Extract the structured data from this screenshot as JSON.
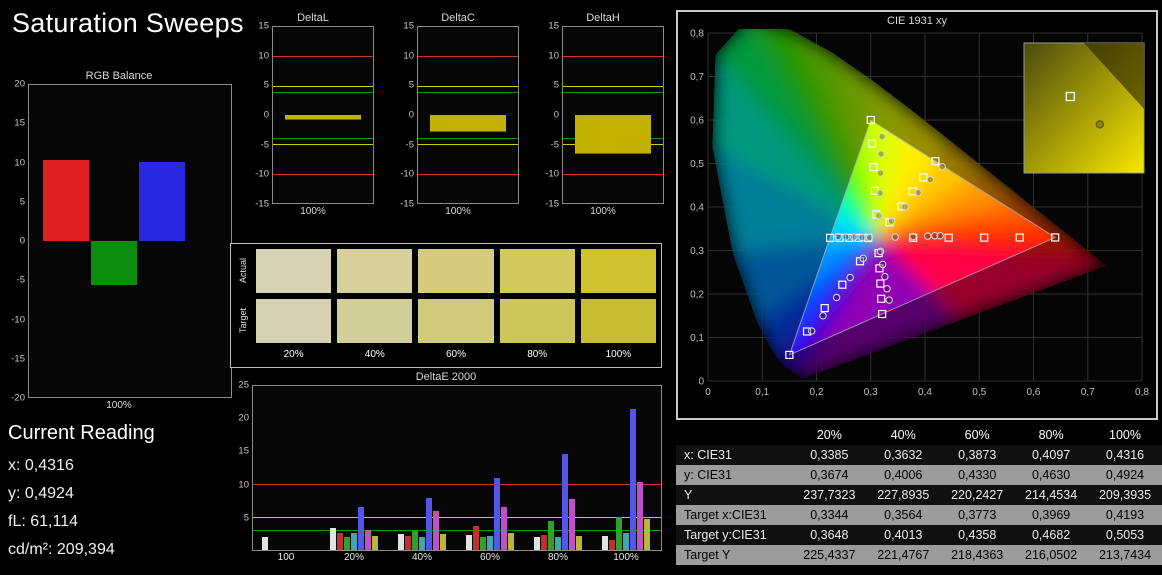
{
  "title": "Saturation Sweeps",
  "rgb_balance": {
    "title": "RGB Balance",
    "xlabel": "100%",
    "ylim": [
      -20,
      20
    ],
    "yticks": [
      20,
      15,
      10,
      5,
      0,
      -5,
      -10,
      -15,
      -20
    ],
    "bars": [
      {
        "name": "red",
        "value": 10.4,
        "color": "#e02020"
      },
      {
        "name": "green",
        "value": -5.6,
        "color": "#0c8c0c"
      },
      {
        "name": "blue",
        "value": 10.1,
        "color": "#2828e0"
      }
    ]
  },
  "current_reading": {
    "heading": "Current Reading",
    "lines": [
      {
        "label": "x:",
        "value": "0,4316"
      },
      {
        "label": "y:",
        "value": "0,4924"
      },
      {
        "label": "fL:",
        "value": "61,114"
      },
      {
        "label": "cd/m²:",
        "value": "209,394"
      }
    ]
  },
  "delta_charts": {
    "ylim": [
      -15,
      15
    ],
    "yticks": [
      15,
      10,
      5,
      0,
      -5,
      -10,
      -15
    ],
    "xlabel": "100%",
    "bar_color": "#c2b200",
    "ref_lines": [
      {
        "value": 10,
        "color": "#e03030"
      },
      {
        "value": 5,
        "color": "#d8d800"
      },
      {
        "value": 4,
        "color": "#00a000"
      },
      {
        "value": -4,
        "color": "#00a000"
      },
      {
        "value": -5,
        "color": "#d8d800"
      },
      {
        "value": -10,
        "color": "#e03030"
      }
    ],
    "charts": [
      {
        "title": "DeltaL",
        "value": -0.6
      },
      {
        "title": "DeltaC",
        "value": -2.7
      },
      {
        "title": "DeltaH",
        "value": -6.5
      }
    ]
  },
  "swatches": {
    "row_labels": [
      "Actual",
      "Target"
    ],
    "col_labels": [
      "20%",
      "40%",
      "60%",
      "80%",
      "100%"
    ],
    "actual_colors": [
      "#d6d3b4",
      "#d6d09a",
      "#d5cd7d",
      "#d2c95c",
      "#cfc22e"
    ],
    "target_colors": [
      "#d4d2b2",
      "#d3cf98",
      "#d0cb7a",
      "#cdc659",
      "#c8bd30"
    ]
  },
  "deltae_chart": {
    "type": "bar",
    "title": "DeltaE 2000",
    "ylim": [
      0,
      25
    ],
    "yticks": [
      25,
      20,
      15,
      10,
      5
    ],
    "ref_lines": [
      {
        "value": 10,
        "color": "#e03030"
      },
      {
        "value": 5,
        "color": "#d8d800"
      },
      {
        "value": 3,
        "color": "#00a000"
      }
    ],
    "groups": [
      "100",
      "20%",
      "40%",
      "60%",
      "80%",
      "100%"
    ],
    "series": [
      {
        "name": "white",
        "color": "#e2e2e2",
        "values": [
          2.0,
          3.4,
          2.4,
          2.3,
          2.0,
          2.2
        ]
      },
      {
        "name": "red",
        "color": "#c03030",
        "values": [
          0,
          2.6,
          2.2,
          3.6,
          2.3,
          1.6
        ]
      },
      {
        "name": "green",
        "color": "#2da02d",
        "values": [
          0,
          2.0,
          2.9,
          2.0,
          4.4,
          5.0
        ]
      },
      {
        "name": "cyan",
        "color": "#3fa8a8",
        "values": [
          0,
          2.6,
          2.0,
          2.2,
          2.0,
          2.6
        ]
      },
      {
        "name": "blue",
        "color": "#5555e8",
        "values": [
          0,
          6.5,
          8.0,
          11.0,
          14.7,
          21.5
        ]
      },
      {
        "name": "magenta",
        "color": "#c050c8",
        "values": [
          0,
          3.0,
          6.0,
          6.6,
          7.8,
          10.4
        ]
      },
      {
        "name": "yellow",
        "color": "#b8b832",
        "values": [
          0,
          2.1,
          2.4,
          2.6,
          2.2,
          4.7
        ]
      }
    ]
  },
  "cie_chart": {
    "type": "scatter",
    "title": "CIE 1931 xy",
    "xlim": [
      0,
      0.8
    ],
    "ylim": [
      0,
      0.8
    ],
    "xticks": [
      "0",
      "0,1",
      "0,2",
      "0,3",
      "0,4",
      "0,5",
      "0,6",
      "0,7",
      "0,8"
    ],
    "yticks": [
      "0",
      "0,1",
      "0,2",
      "0,3",
      "0,4",
      "0,5",
      "0,6",
      "0,7",
      "0,8"
    ],
    "gamut_triangle": [
      [
        0.64,
        0.33
      ],
      [
        0.3,
        0.6
      ],
      [
        0.15,
        0.06
      ]
    ],
    "target_points": [
      [
        0.3782,
        0.3292
      ],
      [
        0.4436,
        0.3294
      ],
      [
        0.5091,
        0.3296
      ],
      [
        0.5745,
        0.3298
      ],
      [
        0.64,
        0.33
      ],
      [
        0.3102,
        0.3832
      ],
      [
        0.3076,
        0.4374
      ],
      [
        0.3051,
        0.4916
      ],
      [
        0.3025,
        0.5458
      ],
      [
        0.3,
        0.6
      ],
      [
        0.2802,
        0.2752
      ],
      [
        0.2476,
        0.2214
      ],
      [
        0.2151,
        0.1676
      ],
      [
        0.1825,
        0.1138
      ],
      [
        0.15,
        0.06
      ],
      [
        0.2952,
        0.329
      ],
      [
        0.2776,
        0.329
      ],
      [
        0.2601,
        0.329
      ],
      [
        0.2425,
        0.329
      ],
      [
        0.225,
        0.329
      ],
      [
        0.3144,
        0.294
      ],
      [
        0.316,
        0.259
      ],
      [
        0.3177,
        0.224
      ],
      [
        0.3193,
        0.189
      ],
      [
        0.321,
        0.154
      ],
      [
        0.3344,
        0.3648
      ],
      [
        0.3564,
        0.4013
      ],
      [
        0.3773,
        0.4358
      ],
      [
        0.3969,
        0.4682
      ],
      [
        0.4193,
        0.5053
      ]
    ],
    "measured_points": [
      [
        0.345,
        0.331
      ],
      [
        0.378,
        0.332
      ],
      [
        0.405,
        0.333
      ],
      [
        0.418,
        0.334
      ],
      [
        0.428,
        0.334
      ],
      [
        0.315,
        0.38
      ],
      [
        0.317,
        0.432
      ],
      [
        0.318,
        0.478
      ],
      [
        0.319,
        0.522
      ],
      [
        0.321,
        0.562
      ],
      [
        0.286,
        0.282
      ],
      [
        0.262,
        0.238
      ],
      [
        0.237,
        0.192
      ],
      [
        0.212,
        0.15
      ],
      [
        0.191,
        0.115
      ],
      [
        0.298,
        0.33
      ],
      [
        0.284,
        0.33
      ],
      [
        0.269,
        0.331
      ],
      [
        0.254,
        0.331
      ],
      [
        0.24,
        0.332
      ],
      [
        0.318,
        0.298
      ],
      [
        0.322,
        0.268
      ],
      [
        0.326,
        0.24
      ],
      [
        0.33,
        0.212
      ],
      [
        0.334,
        0.186
      ],
      [
        0.3385,
        0.3674
      ],
      [
        0.3632,
        0.4006
      ],
      [
        0.3873,
        0.433
      ],
      [
        0.4097,
        0.463
      ],
      [
        0.4316,
        0.4924
      ]
    ],
    "inset": {
      "range_x": [
        0.4,
        0.45
      ],
      "range_y": [
        0.47,
        0.53
      ],
      "target": [
        0.4193,
        0.5053
      ],
      "actual": [
        0.4316,
        0.4924
      ]
    }
  },
  "cie_table": {
    "columns": [
      "",
      "20%",
      "40%",
      "60%",
      "80%",
      "100%"
    ],
    "rows": [
      {
        "label": "x: CIE31",
        "values": [
          "0,3385",
          "0,3632",
          "0,3873",
          "0,4097",
          "0,4316"
        ]
      },
      {
        "label": "y: CIE31",
        "values": [
          "0,3674",
          "0,4006",
          "0,4330",
          "0,4630",
          "0,4924"
        ]
      },
      {
        "label": "Y",
        "values": [
          "237,7323",
          "227,8935",
          "220,2427",
          "214,4534",
          "209,3935"
        ]
      },
      {
        "label": "Target x:CIE31",
        "values": [
          "0,3344",
          "0,3564",
          "0,3773",
          "0,3969",
          "0,4193"
        ]
      },
      {
        "label": "Target y:CIE31",
        "values": [
          "0,3648",
          "0,4013",
          "0,4358",
          "0,4682",
          "0,5053"
        ]
      },
      {
        "label": "Target Y",
        "values": [
          "225,4337",
          "221,4767",
          "218,4363",
          "216,0502",
          "213,7434"
        ]
      }
    ]
  }
}
